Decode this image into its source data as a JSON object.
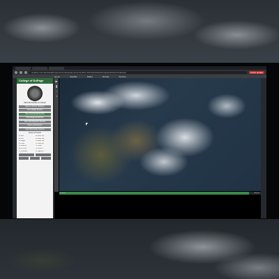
{
  "browser": {
    "address": "weather.cod.edu/satrad/?parms=continental-conus-02-48-1-100-1&checked=map&colorbar=undefined",
    "update_label": "Finish update"
  },
  "site": {
    "nav": [
      "Home",
      "Satellite",
      "Radar",
      "Models",
      "Surface"
    ],
    "logo_text": "College of DuPage",
    "subtitle": "NEXLAB Satellite and Radar",
    "sidebar_buttons": [
      "Select a Sector Category",
      "View Global Sectors",
      "View Continental Sectors",
      "View Regional Sectors",
      "View Sub-Regional Sectors",
      "View Local Sectors",
      "View Mesoscale Sectors"
    ],
    "product_heading": "Select a Product",
    "product_grid": [
      "01 Blue",
      "08 Water Vap",
      "02 Red",
      "09 Water Vap",
      "03 Veggie",
      "10 Water Vap",
      "04 Cirrus",
      "11 Cloud Top",
      "05 Snow/Ice",
      "12 Ozone",
      "06 Part Size",
      "13 Clean IR",
      "07 Shortwave",
      "14 Legacy IR"
    ],
    "timeline_start": "8 Images",
    "timeline_end": "Animate"
  },
  "accent": "#3b8a4a",
  "timeline_progress": 0.94
}
